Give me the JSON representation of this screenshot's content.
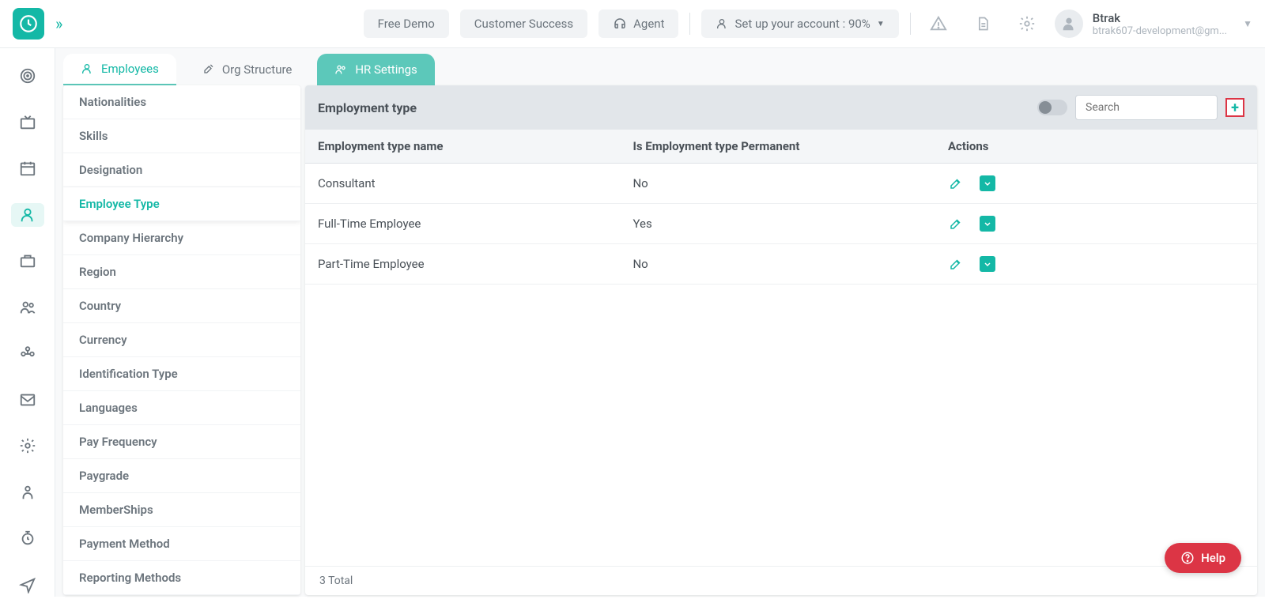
{
  "header": {
    "freeDemo": "Free Demo",
    "customerSuccess": "Customer Success",
    "agent": "Agent",
    "setup": "Set up your account : 90%",
    "userName": "Btrak",
    "userEmail": "btrak607-development@gm..."
  },
  "tabs": {
    "employees": "Employees",
    "orgStructure": "Org Structure",
    "hrSettings": "HR Settings"
  },
  "settings": {
    "items": [
      "Nationalities",
      "Skills",
      "Designation",
      "Employee Type",
      "Company Hierarchy",
      "Region",
      "Country",
      "Currency",
      "Identification Type",
      "Languages",
      "Pay Frequency",
      "Paygrade",
      "MemberShips",
      "Payment Method",
      "Reporting Methods"
    ],
    "activeIndex": 3
  },
  "panel": {
    "title": "Employment type",
    "searchPlaceholder": "Search",
    "columns": {
      "name": "Employment type name",
      "permanent": "Is Employment type Permanent",
      "actions": "Actions"
    },
    "rows": [
      {
        "name": "Consultant",
        "permanent": "No"
      },
      {
        "name": "Full-Time Employee",
        "permanent": "Yes"
      },
      {
        "name": "Part-Time Employee",
        "permanent": "No"
      }
    ],
    "footer": "3 Total"
  },
  "help": "Help"
}
